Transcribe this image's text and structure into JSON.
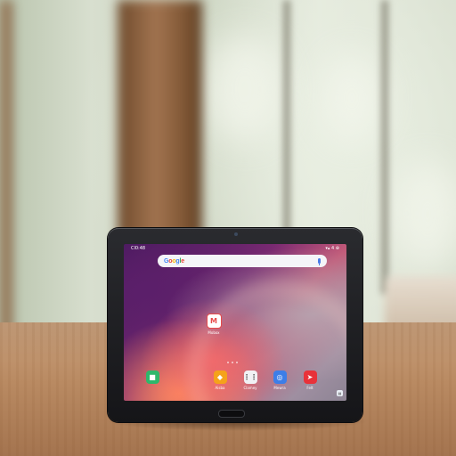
{
  "scene": {
    "description_tag": "tablet-on-table",
    "colors": {
      "curtain": "#8a5d3a",
      "table": "#b98a62",
      "bezel": "#1e1f22"
    }
  },
  "tablet": {
    "status_bar": {
      "time": "Cl0:48",
      "right": "▾▴ 4 ⊕"
    },
    "search_bar": {
      "logo": "Google",
      "logo_letters": [
        "G",
        "o",
        "o",
        "g",
        "l",
        "e"
      ],
      "logo_colors": [
        "#4285f4",
        "#ea4335",
        "#fbbc05",
        "#4285f4",
        "#34a853",
        "#ea4335"
      ],
      "mic_icon": "mic-icon"
    },
    "center_app": {
      "label": "Mobox",
      "glyph": "M",
      "color": "#e84a4a"
    },
    "dock": [
      {
        "label": "",
        "glyph": "■",
        "color": "#2fb76b",
        "icon": "video-icon"
      },
      {
        "label": "Aisba",
        "glyph": "◆",
        "color": "#f5a21b",
        "icon": "app-icon"
      },
      {
        "label": "Clamey",
        "glyph": "⋮⋮",
        "color": "#f1f1f4",
        "icon": "grid-icon"
      },
      {
        "label": "Mewra",
        "glyph": "◎",
        "color": "#3d7ee8",
        "icon": "circle-icon"
      },
      {
        "label": "Felt",
        "glyph": "➤",
        "color": "#e8323a",
        "icon": "arrow-icon"
      }
    ],
    "corner_icon": "▤"
  }
}
